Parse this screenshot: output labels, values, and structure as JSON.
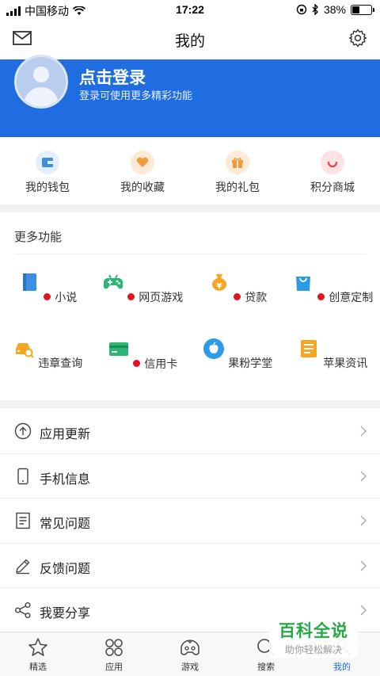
{
  "status_bar": {
    "carrier": "中国移动",
    "time": "17:22",
    "battery": "38%",
    "battery_level": 0.38
  },
  "nav": {
    "title": "我的"
  },
  "header": {
    "login_title": "点击登录",
    "login_subtitle": "登录可使用更多精彩功能",
    "bg_color": "#1f6de0"
  },
  "quick": [
    {
      "label": "我的钱包",
      "icon": "wallet-icon"
    },
    {
      "label": "我的收藏",
      "icon": "heart-icon"
    },
    {
      "label": "我的礼包",
      "icon": "gift-icon"
    },
    {
      "label": "积分商城",
      "icon": "points-mall-icon"
    }
  ],
  "more": {
    "title": "更多功能",
    "items": [
      {
        "label": "小说",
        "icon": "book-icon",
        "dot": true
      },
      {
        "label": "网页游戏",
        "icon": "gamepad-icon",
        "dot": true
      },
      {
        "label": "贷款",
        "icon": "money-bag-icon",
        "dot": true
      },
      {
        "label": "创意定制",
        "icon": "shopping-bag-icon",
        "dot": true
      },
      {
        "label": "违章查询",
        "icon": "car-search-icon",
        "dot": false
      },
      {
        "label": "信用卡",
        "icon": "credit-card-icon",
        "dot": true
      },
      {
        "label": "果粉学堂",
        "icon": "apple-icon",
        "dot": false
      },
      {
        "label": "苹果资讯",
        "icon": "news-icon",
        "dot": false
      }
    ]
  },
  "list": [
    {
      "label": "应用更新",
      "icon": "upload-icon"
    },
    {
      "label": "手机信息",
      "icon": "phone-icon"
    },
    {
      "label": "常见问题",
      "icon": "document-icon"
    },
    {
      "label": "反馈问题",
      "icon": "pencil-icon"
    },
    {
      "label": "我要分享",
      "icon": "share-icon"
    }
  ],
  "tabs": [
    {
      "label": "精选",
      "icon": "star-icon",
      "active": false
    },
    {
      "label": "应用",
      "icon": "apps-icon",
      "active": false
    },
    {
      "label": "游戏",
      "icon": "game-controller-icon",
      "active": false
    },
    {
      "label": "搜索",
      "icon": "search-icon",
      "active": false
    },
    {
      "label": "我的",
      "icon": "profile-icon",
      "active": true
    }
  ],
  "watermark": {
    "title": "百科全说",
    "subtitle": "助你轻松解决"
  }
}
